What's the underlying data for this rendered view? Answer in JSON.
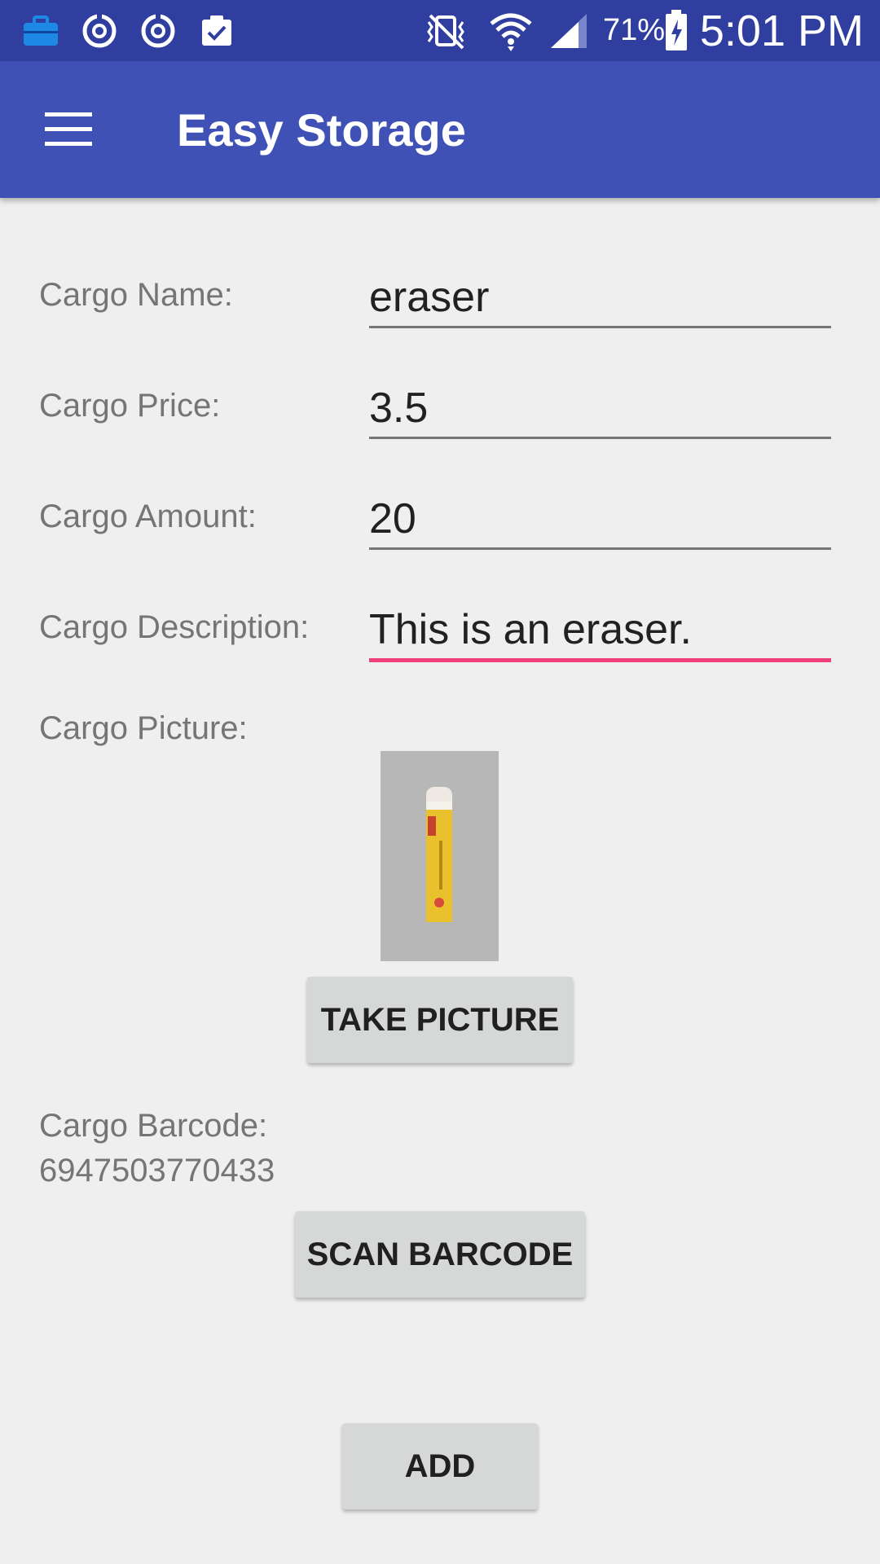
{
  "status_bar": {
    "battery_percent": "71%",
    "time": "5:01 PM",
    "icons": [
      "briefcase-icon",
      "sync-icon",
      "sync-icon",
      "clipboard-check-icon",
      "vibrate-off-icon",
      "wifi-icon",
      "signal-icon",
      "battery-charging-icon"
    ]
  },
  "app_bar": {
    "title": "Easy Storage",
    "menu_icon": "hamburger-menu-icon"
  },
  "form": {
    "name_label": "Cargo Name:",
    "name_value": "eraser",
    "price_label": "Cargo Price:",
    "price_value": "3.5",
    "amount_label": "Cargo Amount:",
    "amount_value": "20",
    "description_label": "Cargo Description:",
    "description_value": "This is an eraser.",
    "picture_label": "Cargo Picture:",
    "take_picture_label": "TAKE PICTURE",
    "barcode_label": "Cargo Barcode:",
    "barcode_value": "6947503770433",
    "scan_barcode_label": "SCAN BARCODE",
    "add_label": "ADD"
  },
  "colors": {
    "status_bar": "#303f9f",
    "app_bar": "#3f51b5",
    "accent": "#ef407a",
    "background": "#efefef"
  }
}
